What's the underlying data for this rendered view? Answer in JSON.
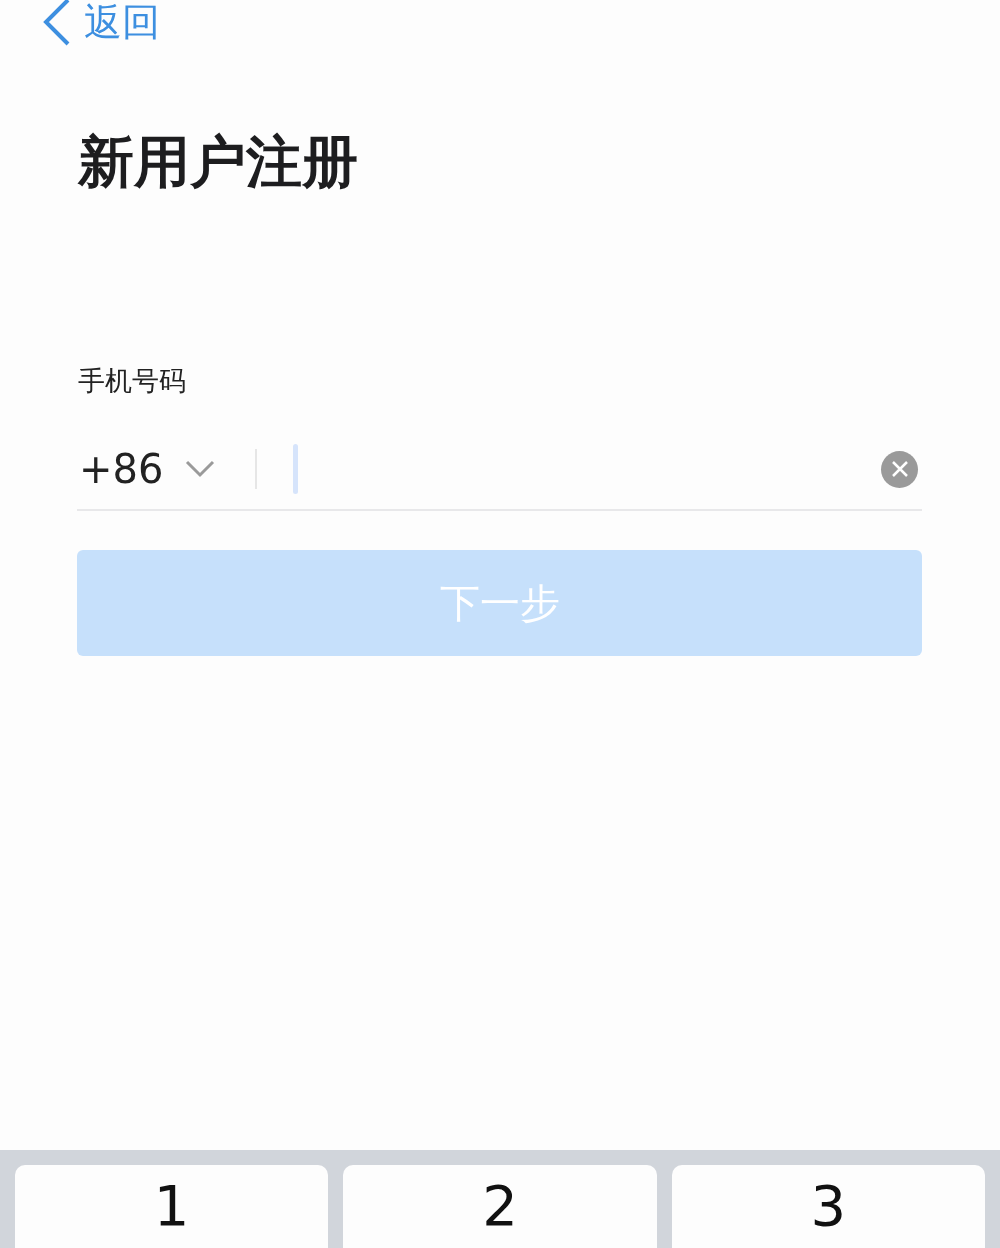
{
  "back": {
    "label": "返回"
  },
  "title": "新用户注册",
  "phone": {
    "label": "手机号码",
    "country_code": "+86"
  },
  "next_button": {
    "label": "下一步",
    "disabled": true
  },
  "keyboard": {
    "keys": [
      {
        "digit": "1"
      },
      {
        "digit": "2"
      },
      {
        "digit": "3"
      }
    ]
  }
}
